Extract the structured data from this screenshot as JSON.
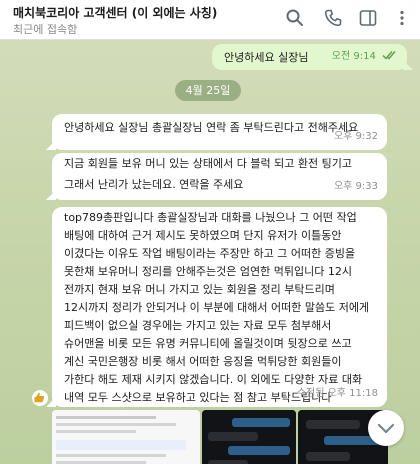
{
  "header": {
    "title": "매치북코리아 고객센터 (이 외에는 사칭)",
    "subtitle": "최근에 접속함"
  },
  "date_separator": "4월 25일",
  "messages": [
    {
      "text": "안녕하세요 실장님",
      "time": "오전 9:14"
    },
    {
      "text": "안녕하세요 실장님 총괄실장님 연락 좀 부탁드린다고 전해주세요",
      "time": "오후 9:32"
    },
    {
      "lines": [
        "지금 회원들 보유 머니 있는 상태에서 다 블럭 되고 환전 팅기고",
        "그래서 난리가 났는데요. 연락을 주세요"
      ],
      "time": "오후 9:33"
    },
    {
      "lines": [
        "top789총판입니다 총괄실장님과 대화를 나눴으나 그 어떤 작업",
        "배팅에 대하여 근거 제시도 못하였으며 단지 유저가 이틀동안",
        "이겼다는 이유도 작업 배팅이라는 주장만 하고 그 어떠한 증빙을",
        "못한채 보유머니 정리를 안해주는것은 엄연한 먹튀입니다 12시",
        "전까지 현재 보유 머니 가지고 있는 회원을 정리 부탁드리며",
        "12시까지 정리가 안되거나 이 부분에 대해서 어떠한 말씀도 저에게",
        "피드백이 없으실 경우에는 가지고 있는 자료 모두 첨부해서",
        "슈어맨을 비롯 모든 유명 커뮤니티에 올릴것이며 뒷장으로 쓰고",
        "계신 국민은행장 비롯 해서 어떠한 응징을 먹튀당한 회원들이",
        "가한다 해도 제재 시키지 않겠습니다. 이 외에도 다양한 자료 대화",
        "내역 모두 스샷으로 보유하고 있다는 점 참고 부탁드립니다"
      ],
      "time": "수정됨 오후 11:18"
    }
  ],
  "thumbs": [
    {
      "lines": [
        "이 외에도 다양한 자료 대화",
        "내역 모두 스샷으로"
      ]
    },
    {
      "lines": [
        "",
        ""
      ]
    },
    {
      "lines": [
        "",
        ""
      ]
    }
  ]
}
